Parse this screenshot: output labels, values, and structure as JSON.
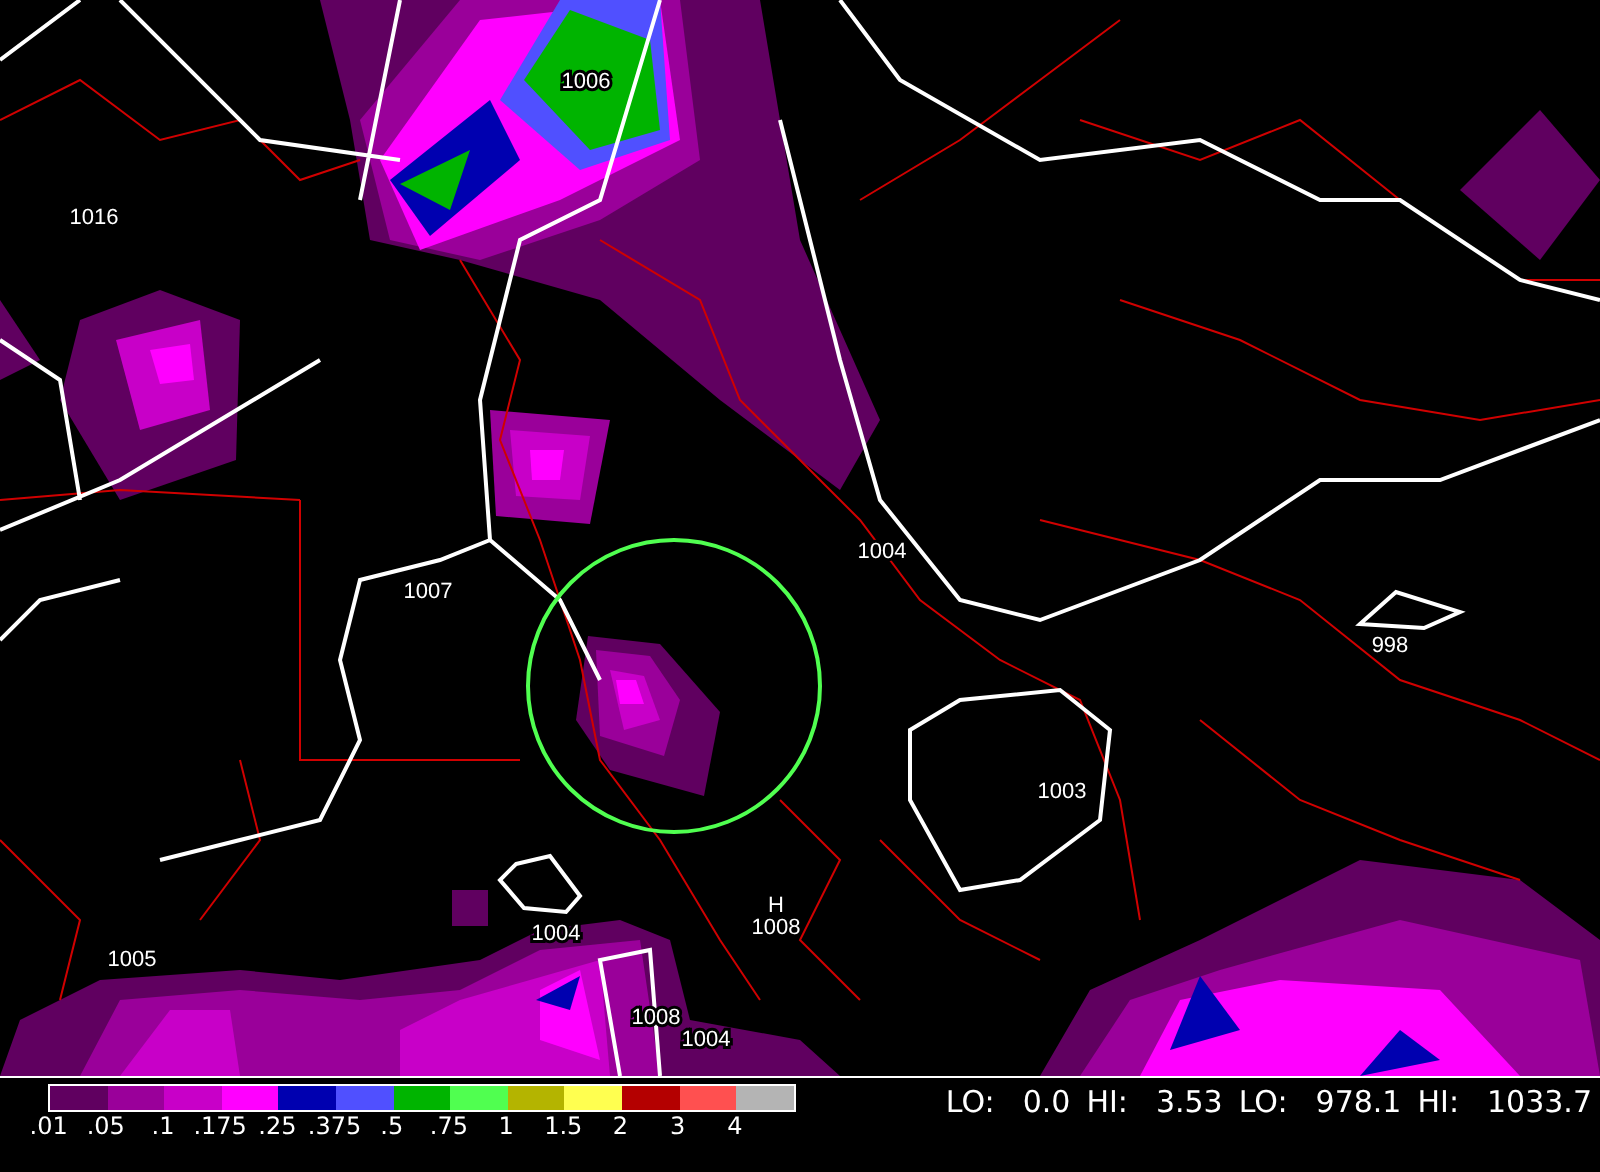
{
  "map": {
    "pressure_labels": [
      {
        "text": "1006"
      },
      {
        "text": "1016"
      },
      {
        "text": "1007"
      },
      {
        "text": "1004"
      },
      {
        "text": "998"
      },
      {
        "text": "1003"
      },
      {
        "text": "1005"
      },
      {
        "text": "1004"
      },
      {
        "text": "H"
      },
      {
        "text": "1008"
      },
      {
        "text": "1008"
      },
      {
        "text": "1004"
      }
    ]
  },
  "legend": {
    "items": [
      {
        "label": ".01",
        "color": "#600060"
      },
      {
        "label": ".05",
        "color": "#9a009a"
      },
      {
        "label": ".1",
        "color": "#c800c8"
      },
      {
        "label": ".175",
        "color": "#ff00ff"
      },
      {
        "label": ".25",
        "color": "#0000b0"
      },
      {
        "label": ".375",
        "color": "#5050ff"
      },
      {
        "label": ".5",
        "color": "#00b400"
      },
      {
        "label": ".75",
        "color": "#50ff50"
      },
      {
        "label": "1",
        "color": "#b4b400"
      },
      {
        "label": "1.5",
        "color": "#ffff50"
      },
      {
        "label": "2",
        "color": "#b40000"
      },
      {
        "label": "3",
        "color": "#ff5050"
      },
      {
        "label": "4",
        "color": "#b4b4b4"
      }
    ]
  },
  "stats": [
    {
      "label": "LO:",
      "value": "0.0"
    },
    {
      "label": "HI:",
      "value": "3.53"
    },
    {
      "label": "LO:",
      "value": "978.1"
    },
    {
      "label": "HI:",
      "value": "1033.7"
    }
  ]
}
